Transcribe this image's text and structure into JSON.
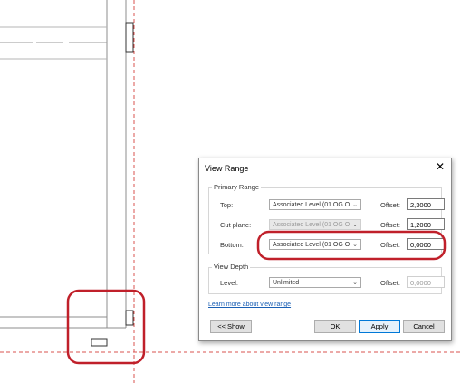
{
  "dialog": {
    "title": "View Range",
    "close_glyph": "✕",
    "primary_range": {
      "label": "Primary Range",
      "rows": [
        {
          "label": "Top:",
          "level": "Associated Level (01 OG O",
          "offset_label": "Offset:",
          "offset": "2,3000",
          "level_enabled": true,
          "offset_enabled": true
        },
        {
          "label": "Cut plane:",
          "level": "Associated Level (01 OG O",
          "offset_label": "Offset:",
          "offset": "1,2000",
          "level_enabled": false,
          "offset_enabled": true
        },
        {
          "label": "Bottom:",
          "level": "Associated Level (01 OG O",
          "offset_label": "Offset:",
          "offset": "0,0000",
          "level_enabled": true,
          "offset_enabled": true
        }
      ]
    },
    "view_depth": {
      "label": "View Depth",
      "level_label": "Level:",
      "level": "Unlimited",
      "offset_label": "Offset:",
      "offset": "0,0000"
    },
    "learn_more_link": "Learn more about view range",
    "buttons": {
      "show": "<< Show",
      "ok": "OK",
      "apply": "Apply",
      "cancel": "Cancel"
    }
  },
  "colors": {
    "annotation": "#c0202a",
    "dashed_line": "#d9534f",
    "wall": "#8c8c8c",
    "accent": "#0078d7"
  },
  "icons": {
    "dropdown": "chevron-down-icon",
    "close": "close-icon"
  }
}
